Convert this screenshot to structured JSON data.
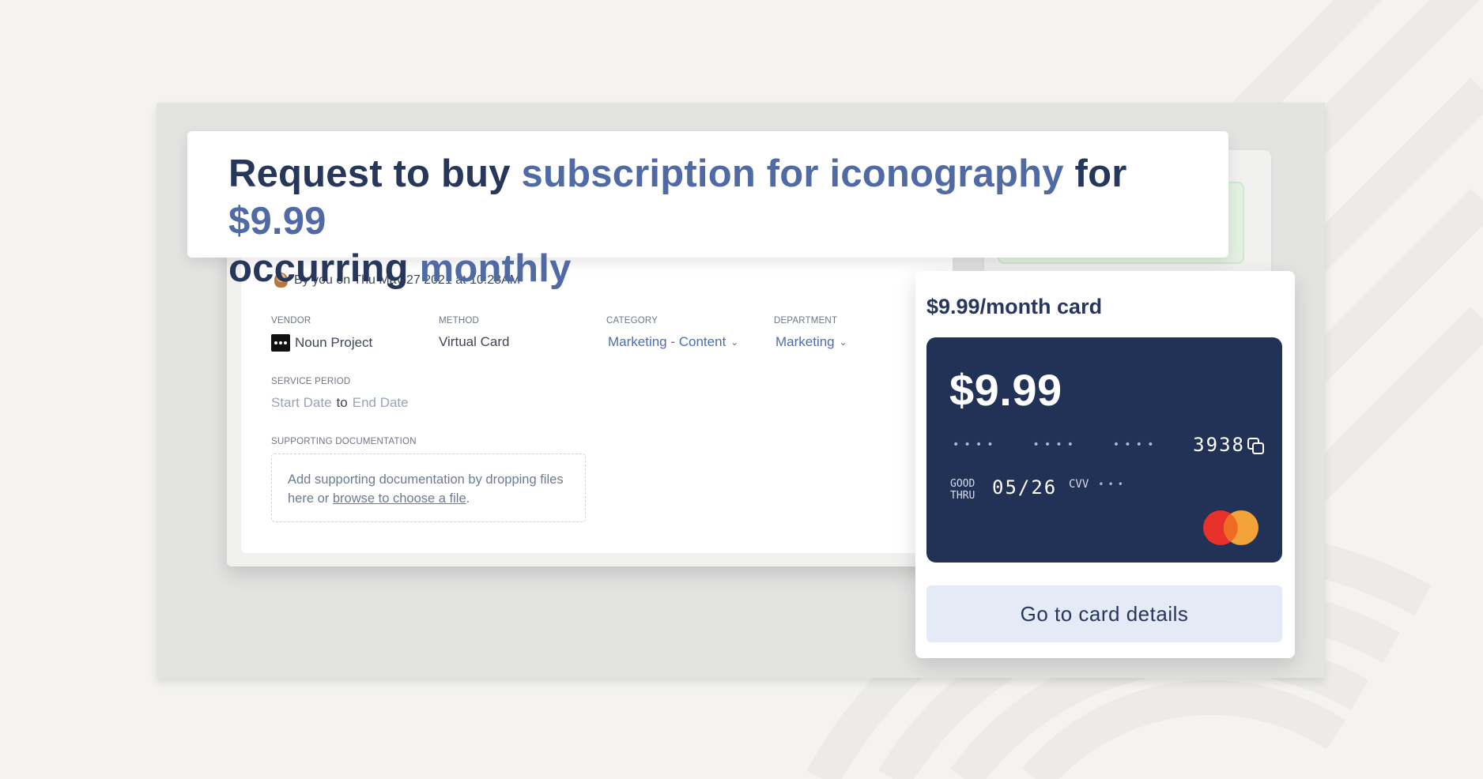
{
  "title": {
    "part1": "Request to buy ",
    "item": "subscription for iconography",
    "part2": " for ",
    "amount": "$9.99",
    "part3": "occurring ",
    "frequency": "monthly"
  },
  "request": {
    "meta": "By you on Thu May 27 2021 at 10:28AM",
    "vendor_label": "VENDOR",
    "vendor_value": "Noun Project",
    "method_label": "METHOD",
    "method_value": "Virtual Card",
    "category_label": "CATEGORY",
    "category_value": "Marketing - Content",
    "department_label": "DEPARTMENT",
    "department_value": "Marketing",
    "service_period_label": "SERVICE PERIOD",
    "start_placeholder": "Start Date",
    "to_word": "to",
    "end_placeholder": "End Date",
    "docs_label": "SUPPORTING DOCUMENTATION",
    "docs_text": "Add supporting documentation by dropping files here or ",
    "docs_link": "browse to choose a file",
    "docs_end": "."
  },
  "card": {
    "popover_title": "$9.99/month card",
    "amount": "$9.99",
    "masked_group_1": "••••",
    "masked_group_2": "••••",
    "masked_group_3": "••••",
    "last4": "3938",
    "good_thru_line1": "GOOD",
    "good_thru_line2": "THRU",
    "expiry": "05/26",
    "cvv_label": "CVV",
    "cvv_masked": "•••",
    "network_icon": "mastercard-logo",
    "details_button": "Go to card details"
  },
  "colors": {
    "navy": "#26375b",
    "accent_blue": "#4f6aa4",
    "card_bg": "#223156",
    "button_bg": "#e4ebf7"
  }
}
